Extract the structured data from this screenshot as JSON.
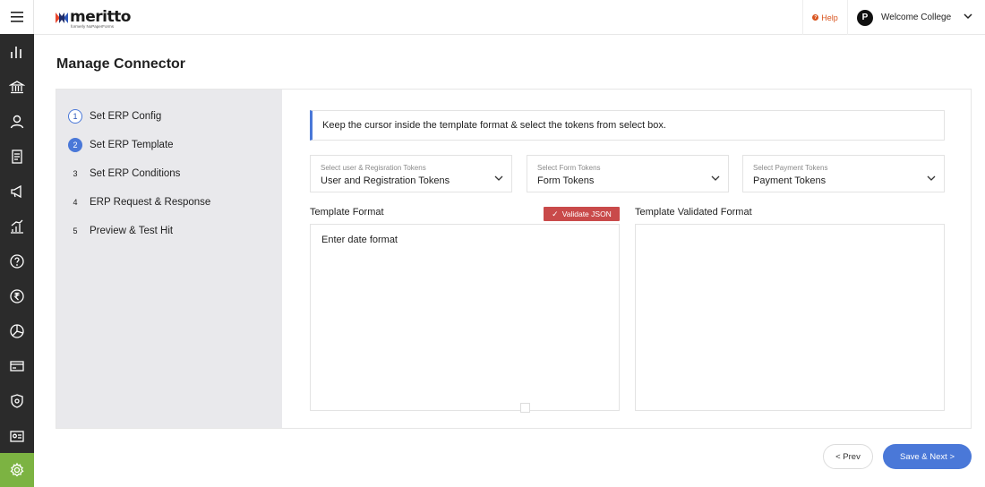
{
  "brand": {
    "name": "meritto",
    "tagline": "formerly NoPaperForms",
    "accent": "#4a78d8"
  },
  "header": {
    "help_label": "Help",
    "help_icon_text": "?",
    "avatar_letter": "P",
    "college_name": "Welcome College"
  },
  "sidebar": {
    "items": [
      "menu-icon",
      "bar-chart-icon",
      "institution-icon",
      "user-icon",
      "document-icon",
      "megaphone-icon",
      "growth-chart-icon",
      "help-circle-icon",
      "rupee-icon",
      "pie-chart-icon",
      "card-icon",
      "shield-icon",
      "id-card-icon",
      "settings-icon"
    ],
    "active": "settings-icon"
  },
  "page": {
    "title": "Manage Connector"
  },
  "steps": [
    {
      "num": "1",
      "label": "Set ERP Config"
    },
    {
      "num": "2",
      "label": "Set ERP Template"
    },
    {
      "num": "3",
      "label": "Set ERP Conditions"
    },
    {
      "num": "4",
      "label": "ERP Request & Response"
    },
    {
      "num": "5",
      "label": "Preview & Test Hit"
    }
  ],
  "info_text": "Keep the cursor inside the template format & select the tokens from select box.",
  "selects": [
    {
      "label": "Select user & Regisration Tokens",
      "value": "User and Registration Tokens"
    },
    {
      "label": "Select Form Tokens",
      "value": "Form Tokens"
    },
    {
      "label": "Select Payment Tokens",
      "value": "Payment Tokens"
    }
  ],
  "template": {
    "format_label": "Template Format",
    "validate_label": "Validate JSON",
    "placeholder": "Enter date format",
    "validated_label": "Template Validated Format"
  },
  "footer": {
    "prev_label": "< Prev",
    "next_label": "Save & Next >"
  },
  "colors": {
    "validate": "#c94a4a",
    "active_sidebar": "#7cb342",
    "sidebar_bg": "#2b2b2b"
  }
}
